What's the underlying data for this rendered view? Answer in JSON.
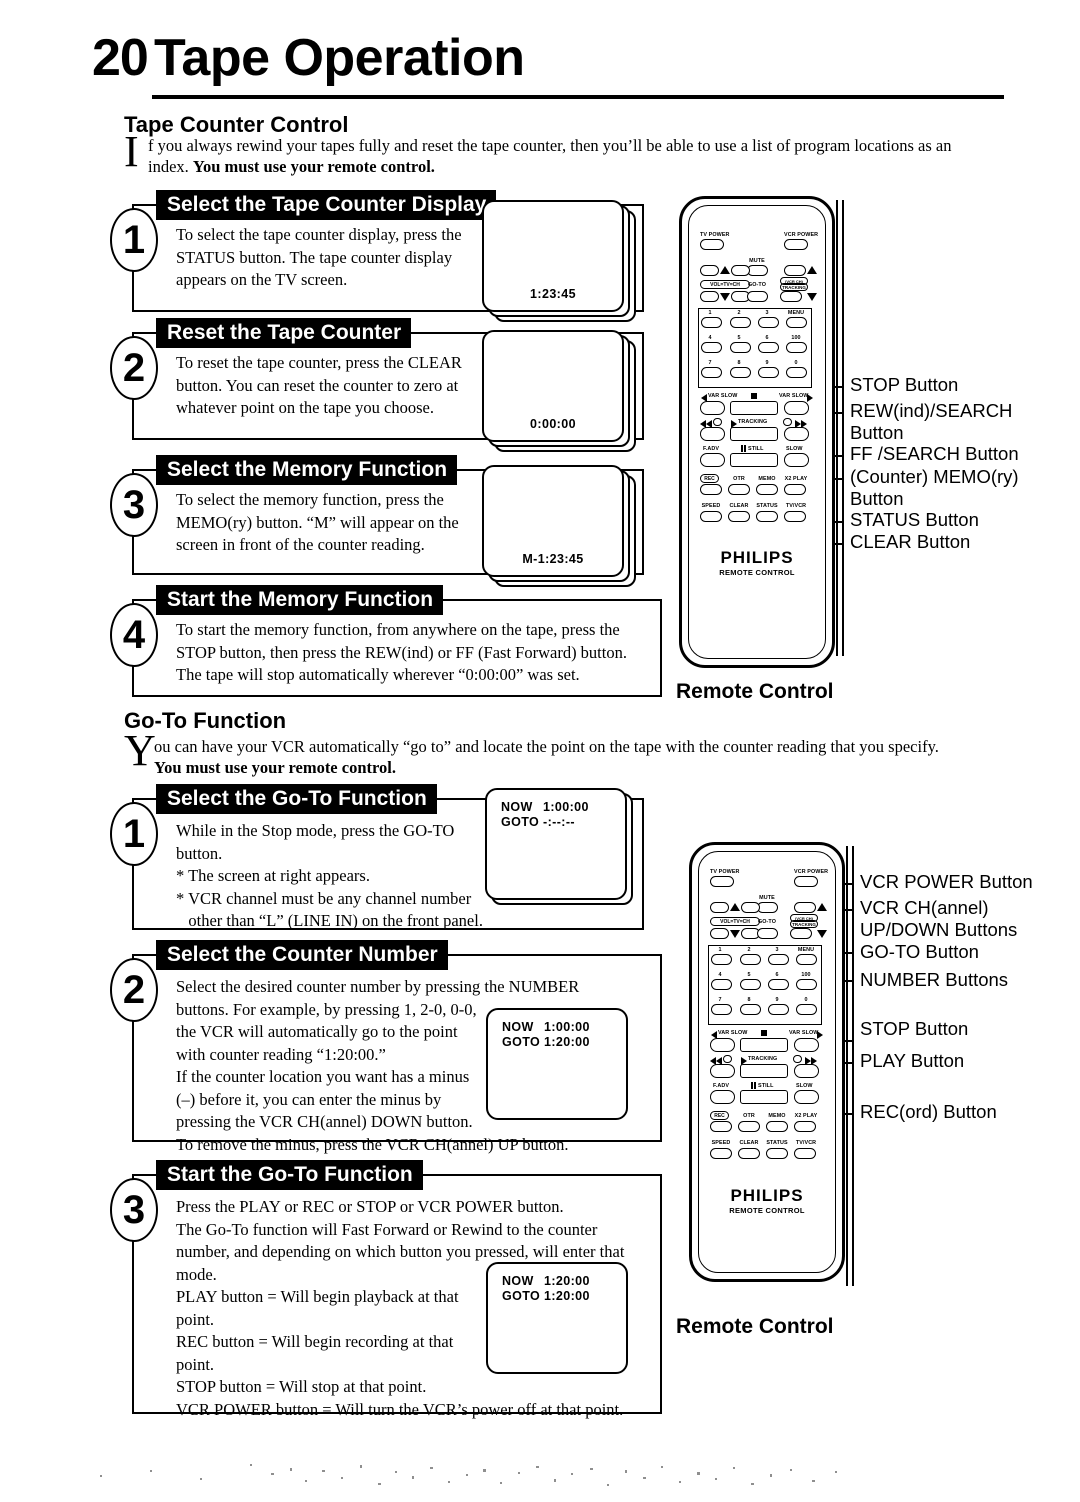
{
  "page": {
    "number": "20",
    "title": "Tape Operation"
  },
  "section1": {
    "heading": "Tape Counter Control",
    "dropcap": "I",
    "intro_line1": "f you always rewind your tapes fully and reset the tape counter, then you’ll be able to use a list of program locations as an",
    "intro_line2_plain": "index. ",
    "intro_line2_bold": "You must use your remote control.",
    "steps": [
      {
        "num": "1",
        "title": "Select the Tape Counter Display",
        "lines": [
          "To select the tape counter display, press the",
          "STATUS button. The tape counter display",
          "appears on the TV screen."
        ],
        "screen": {
          "counter": "1:23:45"
        }
      },
      {
        "num": "2",
        "title": "Reset the Tape Counter",
        "lines": [
          "To reset the tape counter, press the CLEAR",
          "button. You can reset the counter to zero at",
          "whatever point on the tape you choose."
        ],
        "screen": {
          "counter": "0:00:00"
        }
      },
      {
        "num": "3",
        "title": "Select the Memory Function",
        "lines": [
          "To select the memory function, press the",
          "MEMO(ry) button. “M” will appear on the",
          "screen in front of the counter reading."
        ],
        "screen": {
          "counter": "M-1:23:45"
        }
      },
      {
        "num": "4",
        "title": "Start the Memory Function",
        "lines": [
          "To start the memory function, from anywhere on the tape, press the",
          "STOP button, then press the REW(ind) or FF (Fast Forward) button.",
          "The tape will stop automatically wherever “0:00:00” was set."
        ]
      }
    ],
    "callouts": [
      "STOP Button",
      "REW(ind)/SEARCH\nButton",
      "FF /SEARCH Button",
      "(Counter) MEMO(ry)\nButton",
      "STATUS Button",
      "CLEAR Button"
    ],
    "remote_caption": "Remote Control"
  },
  "section2": {
    "heading": "Go-To Function",
    "dropcap": "Y",
    "intro_line1": "ou can have your VCR automatically “go to” and locate the point on the tape with the counter reading that you specify.",
    "intro_line2_bold": "You must use your remote control.",
    "steps": [
      {
        "num": "1",
        "title": "Select the Go-To Function",
        "lines": [
          "While in the Stop mode, press the GO-TO",
          "button.",
          "* The screen at right appears.",
          "* VCR channel must be any channel number",
          "   other than “L” (LINE IN) on the front panel."
        ],
        "screen": {
          "now_label": "NOW",
          "now_value": "1:00:00",
          "goto_label": "GOTO",
          "goto_value": "-:--:--"
        }
      },
      {
        "num": "2",
        "title": "Select the Counter Number",
        "lines": [
          "Select the desired counter number by pressing the NUMBER",
          "buttons. For example, by pressing 1, 2-0, 0-0,",
          "the VCR will automatically go to the point",
          "with counter reading “1:20:00.”",
          "If the counter location you want has a minus",
          "(–) before it, you can enter the minus by",
          "pressing the VCR CH(annel) DOWN button.",
          "To remove the minus, press the VCR CH(annel) UP button."
        ],
        "screen": {
          "now_label": "NOW",
          "now_value": "1:00:00",
          "goto_label": "GOTO",
          "goto_value": "1:20:00"
        }
      },
      {
        "num": "3",
        "title": "Start the Go-To Function",
        "lines": [
          "Press the PLAY or REC or STOP or VCR POWER button.",
          "The Go-To function will Fast Forward or Rewind to the counter",
          "number, and depending on which button you pressed, will enter that",
          "mode.",
          "PLAY button = Will begin playback at that",
          "point.",
          "REC button = Will begin recording at that",
          "point.",
          "STOP button = Will stop at that point.",
          "VCR POWER button = Will turn the VCR’s power off at that point."
        ],
        "screen": {
          "now_label": "NOW",
          "now_value": "1:20:00",
          "goto_label": "GOTO",
          "goto_value": "1:20:00"
        }
      }
    ],
    "callouts": [
      "VCR POWER Button",
      "VCR CH(annel)\nUP/DOWN Buttons",
      "GO-TO Button",
      "NUMBER Buttons",
      "STOP Button",
      "PLAY Button",
      "REC(ord) Button"
    ],
    "remote_caption": "Remote Control"
  },
  "remote": {
    "brand": "PHILIPS",
    "brand_sub": "REMOTE CONTROL",
    "labels": {
      "tv_power": "TV POWER",
      "vcr_power": "VCR POWER",
      "mute": "MUTE",
      "vol": "VOL=TV=CH",
      "goto": "GO-TO",
      "tracking": "(VCR CH)\nTRACKING",
      "menu": "MENU",
      "f100": "100",
      "var_slow_left": "VAR SLOW",
      "var_slow_right": "VAR SLOW",
      "tracking_bar": "TRACKING",
      "fadv": "F.ADV",
      "still": "STILL",
      "slow": "SLOW",
      "rec": "REC",
      "otr": "OTR",
      "memo": "MEMO",
      "x2play": "X2 PLAY",
      "speed": "SPEED",
      "clear": "CLEAR",
      "status": "STATUS",
      "tvvcr": "TV/VCR",
      "keys": [
        "1",
        "2",
        "3",
        "4",
        "5",
        "6",
        "7",
        "8",
        "9",
        "0"
      ]
    }
  }
}
